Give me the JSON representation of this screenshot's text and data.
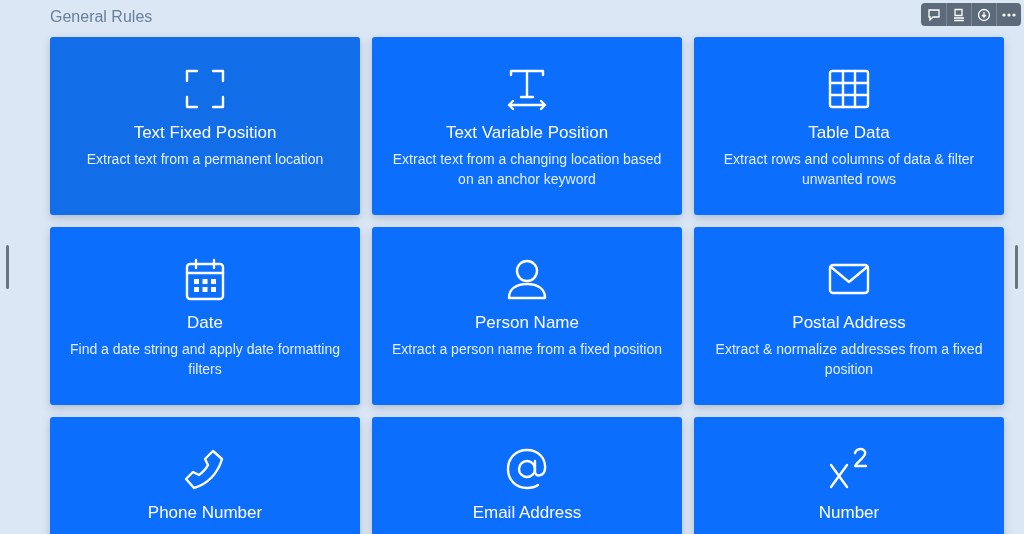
{
  "section_title": "General Rules",
  "toolbar": [
    {
      "kind": "comment"
    },
    {
      "kind": "layout"
    },
    {
      "kind": "download"
    },
    {
      "kind": "more"
    }
  ],
  "cards": [
    {
      "kind": "fixed",
      "title": "Text Fixed Position",
      "description": "Extract text from a permanent location",
      "selected": true
    },
    {
      "kind": "variable",
      "title": "Text Variable Position",
      "description": "Extract text from a changing location based on an anchor keyword",
      "selected": false
    },
    {
      "kind": "table",
      "title": "Table Data",
      "description": "Extract rows and columns of data & filter unwanted rows",
      "selected": false
    },
    {
      "kind": "date",
      "title": "Date",
      "description": "Find a date string and apply date formatting filters",
      "selected": false
    },
    {
      "kind": "person",
      "title": "Person Name",
      "description": "Extract a person name from a fixed position",
      "selected": false
    },
    {
      "kind": "mail",
      "title": "Postal Address",
      "description": "Extract & normalize addresses from a fixed position",
      "selected": false
    },
    {
      "kind": "phone",
      "title": "Phone Number",
      "selected": false
    },
    {
      "kind": "at",
      "title": "Email Address",
      "selected": false
    },
    {
      "kind": "power",
      "title": "Number",
      "selected": false
    }
  ]
}
